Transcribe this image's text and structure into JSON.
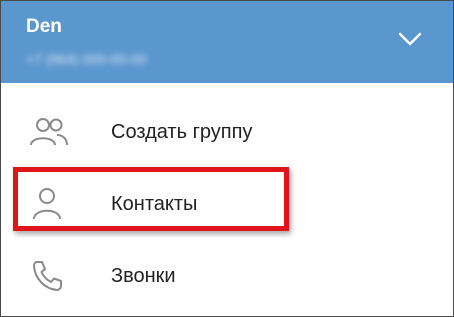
{
  "header": {
    "user_name": "Den",
    "user_phone": "+7 (964) 000-00-00",
    "expand_icon": "chevron-down-icon"
  },
  "menu": {
    "items": [
      {
        "label": "Создать группу",
        "icon": "group-icon"
      },
      {
        "label": "Контакты",
        "icon": "person-icon"
      },
      {
        "label": "Звонки",
        "icon": "phone-icon"
      }
    ]
  },
  "colors": {
    "header_bg": "#5b97cf",
    "highlight_border": "#e0141b",
    "icon_stroke": "#8a8a8a"
  }
}
